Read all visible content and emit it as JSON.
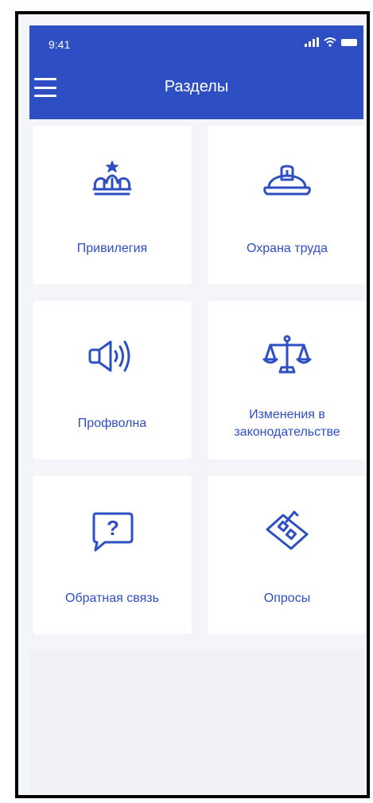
{
  "status_bar": {
    "time": "9:41"
  },
  "header": {
    "title": "Разделы"
  },
  "sections": [
    {
      "label": "Привилегия",
      "icon": "crown-icon"
    },
    {
      "label": "Охрана труда",
      "icon": "hard-hat-icon"
    },
    {
      "label": "Профволна",
      "icon": "speaker-icon"
    },
    {
      "label": "Изменения в законодательстве",
      "icon": "scales-icon"
    },
    {
      "label": "Обратная связь",
      "icon": "question-bubble-icon"
    },
    {
      "label": "Опросы",
      "icon": "ballot-icon"
    }
  ],
  "colors": {
    "accent": "#2e4fc4",
    "background": "#f4f5f8",
    "card": "#ffffff"
  }
}
